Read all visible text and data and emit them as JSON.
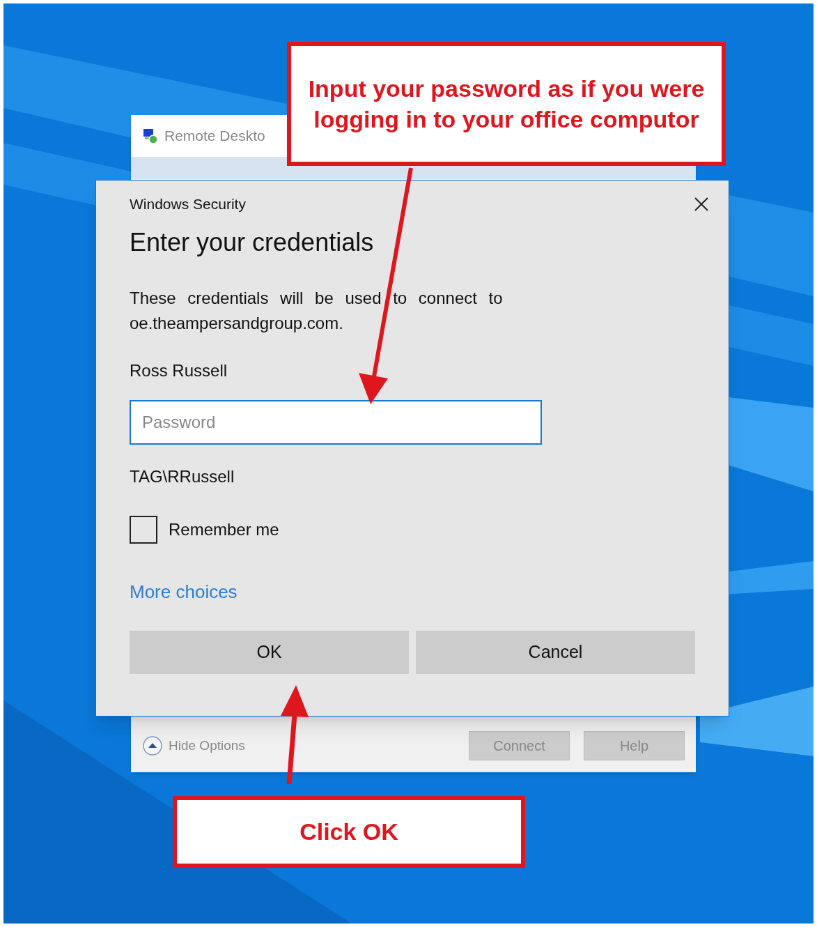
{
  "remote_desktop_window": {
    "title": "Remote Deskto",
    "hide_options": "Hide Options",
    "buttons": [
      "Connect",
      "Help"
    ]
  },
  "security_dialog": {
    "title": "Windows Security",
    "heading": "Enter your credentials",
    "message": "These credentials will be used to connect to oe.theampersandgroup.com.",
    "user_name": "Ross Russell",
    "password": {
      "placeholder": "Password"
    },
    "account": "TAG\\RRussell",
    "remember_me": {
      "label": "Remember me",
      "checked": false
    },
    "more_choices": "More choices",
    "buttons": [
      "OK",
      "Cancel"
    ]
  },
  "callouts": [
    {
      "text": "Input your password as if you were logging in to your office computor"
    },
    {
      "text": "Click OK"
    }
  ]
}
